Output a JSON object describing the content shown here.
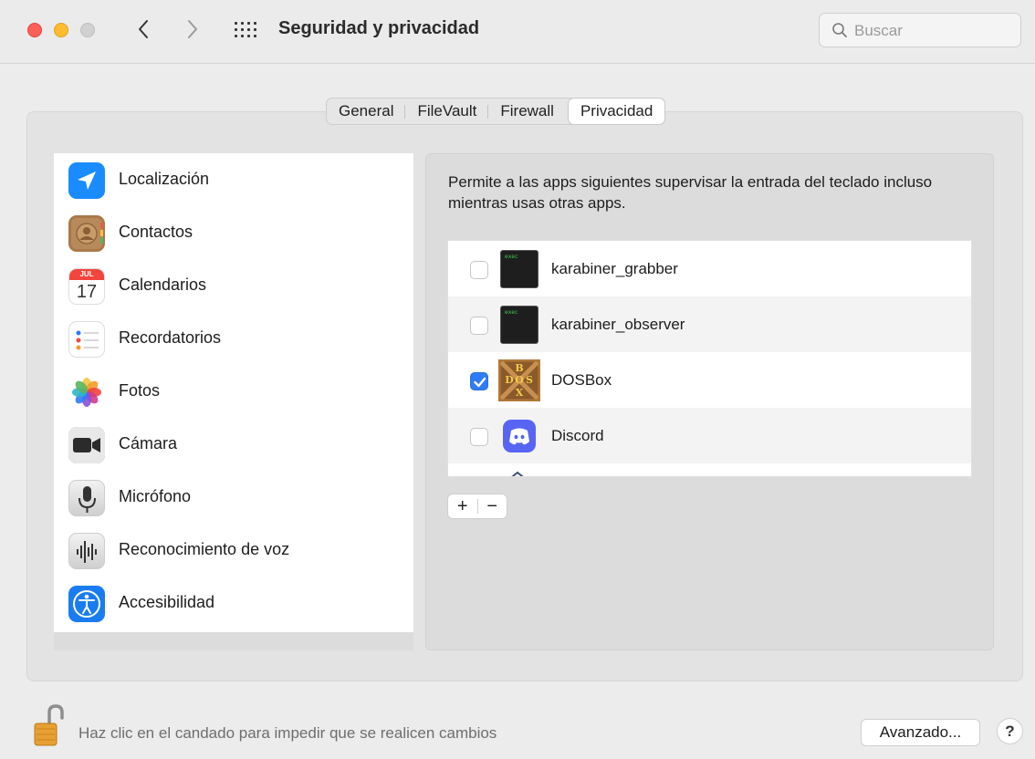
{
  "window": {
    "title": "Seguridad y privacidad",
    "traffic_lights": [
      "close",
      "minimize",
      "zoom"
    ]
  },
  "nav": {
    "back_icon": "chevron-left-icon",
    "forward_icon": "chevron-right-icon",
    "grid_icon": "show-all-grid-icon"
  },
  "search": {
    "placeholder": "Buscar",
    "value": ""
  },
  "tabs": [
    {
      "label": "General",
      "active": false
    },
    {
      "label": "FileVault",
      "active": false
    },
    {
      "label": "Firewall",
      "active": false
    },
    {
      "label": "Privacidad",
      "active": true
    }
  ],
  "categories": [
    {
      "label": "Localización",
      "icon": "location-icon"
    },
    {
      "label": "Contactos",
      "icon": "contacts-icon"
    },
    {
      "label": "Calendarios",
      "icon": "calendar-icon",
      "calendar_month": "JUL",
      "calendar_day": "17"
    },
    {
      "label": "Recordatorios",
      "icon": "reminders-icon"
    },
    {
      "label": "Fotos",
      "icon": "photos-icon"
    },
    {
      "label": "Cámara",
      "icon": "camera-icon"
    },
    {
      "label": "Micrófono",
      "icon": "microphone-icon"
    },
    {
      "label": "Reconocimiento de voz",
      "icon": "speech-recognition-icon"
    },
    {
      "label": "Accesibilidad",
      "icon": "accessibility-icon"
    }
  ],
  "main": {
    "description": "Permite a las apps siguientes supervisar la entrada del teclado incluso mientras usas otras apps.",
    "apps": [
      {
        "name": "karabiner_grabber",
        "checked": false,
        "icon": "exec-terminal-icon",
        "icon_text": "exec"
      },
      {
        "name": "karabiner_observer",
        "checked": false,
        "icon": "exec-terminal-icon",
        "icon_text": "exec"
      },
      {
        "name": "DOSBox",
        "checked": true,
        "icon": "dosbox-icon"
      },
      {
        "name": "Discord",
        "checked": false,
        "icon": "discord-icon"
      }
    ],
    "add_label": "+",
    "remove_label": "−"
  },
  "footer": {
    "lock_text": "Haz clic en el candado para impedir que se realicen cambios",
    "lock_icon": "unlocked-padlock-icon",
    "advanced_label": "Avanzado...",
    "help_label": "?"
  },
  "colors": {
    "accent": "#2f7cf6",
    "window_bg": "#ececec",
    "close": "#fe5f57",
    "minimize": "#febc2e"
  }
}
